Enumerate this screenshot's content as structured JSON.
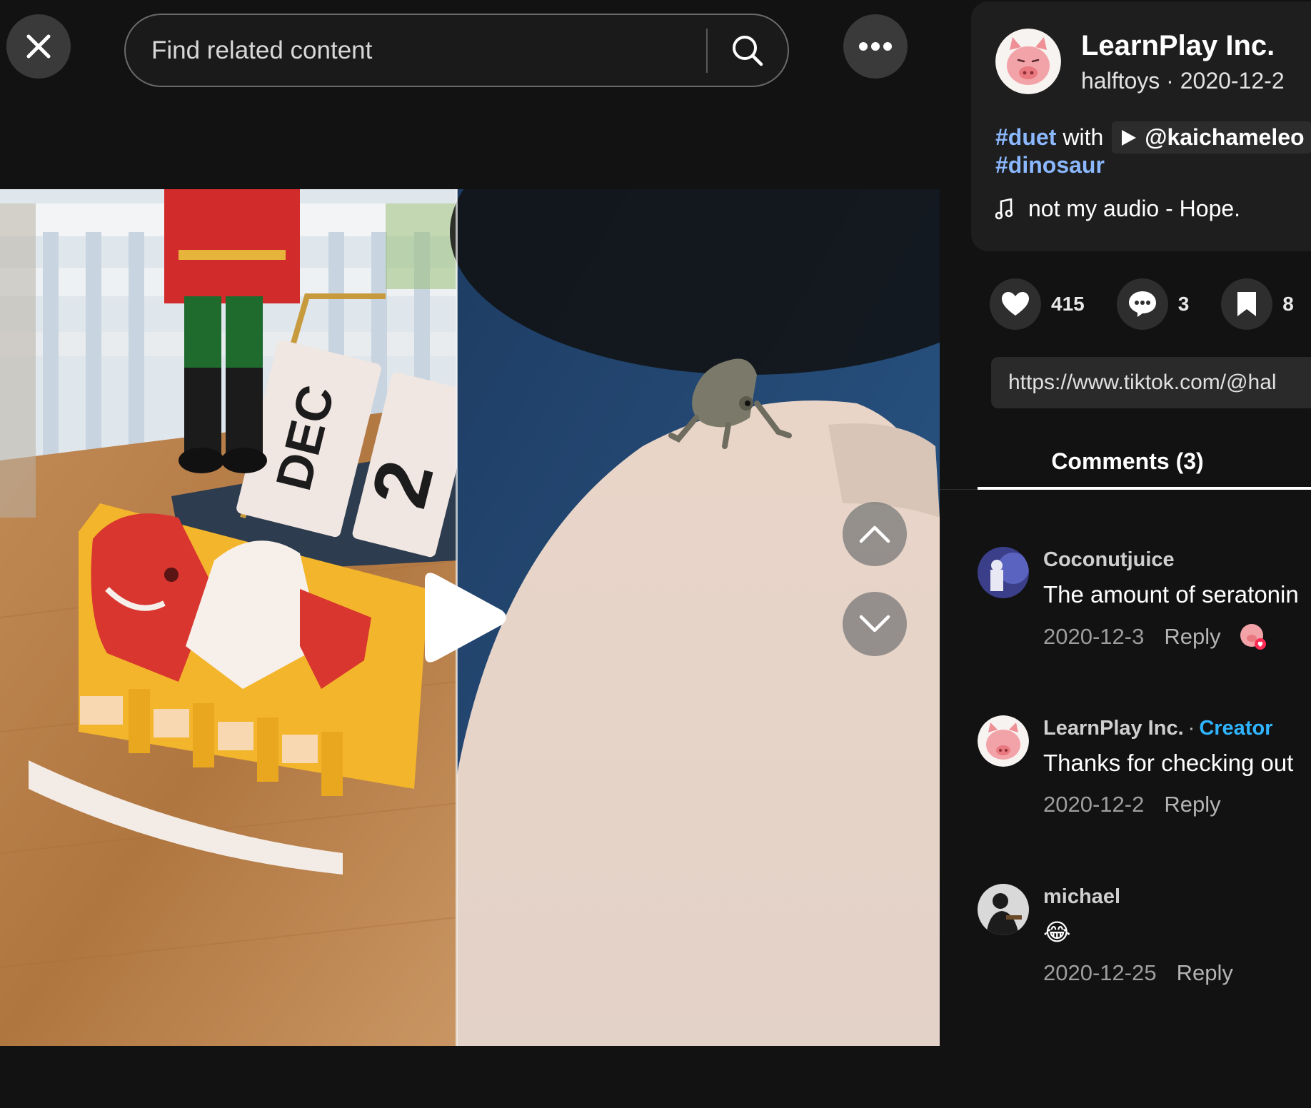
{
  "header": {
    "search_placeholder": "Find related content",
    "close_icon": "close-icon",
    "search_icon": "search-icon",
    "more_icon": "more-options-icon"
  },
  "video": {
    "calendar_month": "DEC",
    "calendar_day": "2",
    "play_icon": "play-icon",
    "prev_icon": "chevron-up-icon",
    "next_icon": "chevron-down-icon"
  },
  "author": {
    "display_name": "LearnPlay Inc.",
    "handle": "halftoys",
    "separator": "·",
    "date": "2020-12-2"
  },
  "description": {
    "hashtag1": "#duet",
    "with": "with",
    "mention": "@kaichameleo",
    "hashtag2": "#dinosaur",
    "music": "not my audio - Hope.",
    "music_icon": "music-note-icon"
  },
  "actions": {
    "likes": "415",
    "comments": "3",
    "saves": "8"
  },
  "share_link": "https://www.tiktok.com/@hal",
  "tabs": {
    "comments_label": "Comments (3)"
  },
  "comments": [
    {
      "user": "Coconutjuice",
      "text": "The amount of seratonin",
      "date": "2020-12-3",
      "reply": "Reply"
    },
    {
      "user": "LearnPlay Inc.",
      "separator": "·",
      "badge": "Creator",
      "text": "Thanks for checking out",
      "date": "2020-12-2",
      "reply": "Reply"
    },
    {
      "user": "michael",
      "text": "😂",
      "date": "2020-12-25",
      "reply": "Reply"
    }
  ],
  "colors": {
    "background": "#121212",
    "card": "#1e1e1e",
    "hashtag": "#8bb8ff",
    "creator_badge": "#2fb4ff"
  }
}
